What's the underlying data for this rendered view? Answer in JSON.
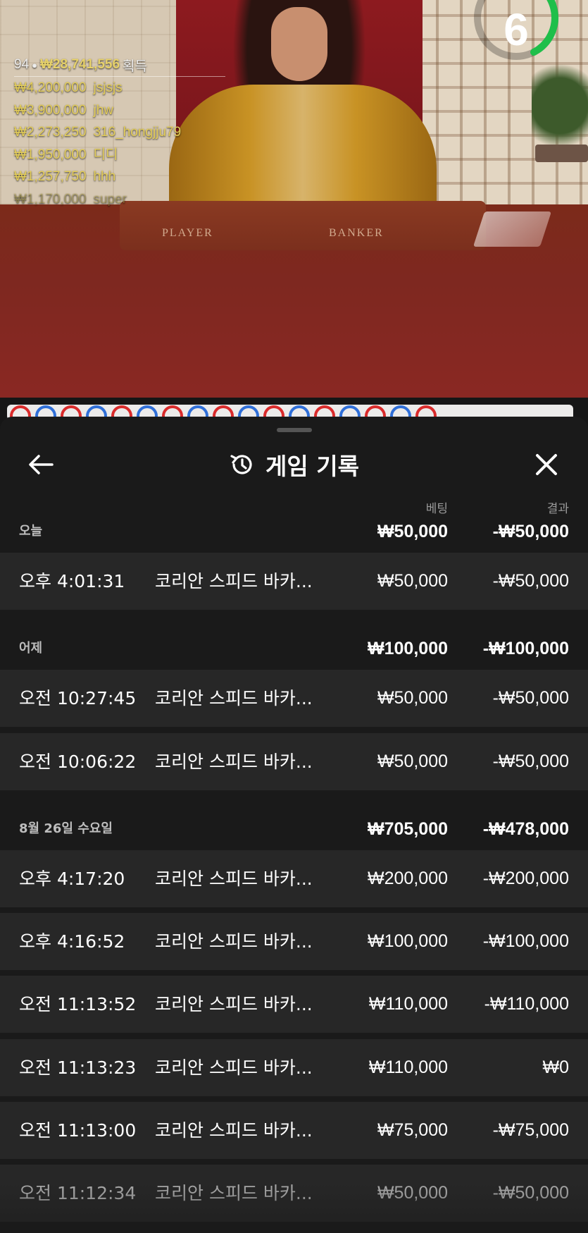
{
  "stream": {
    "countdown": "6",
    "table_labels": {
      "player": "PLAYER",
      "banker": "BANKER"
    }
  },
  "winners": {
    "count": "94",
    "total": "₩28,741,556",
    "suffix": "획득",
    "list": [
      {
        "amount": "₩4,200,000",
        "name": "jsjsjs"
      },
      {
        "amount": "₩3,900,000",
        "name": "jhw"
      },
      {
        "amount": "₩2,273,250",
        "name": "316_hongjju79"
      },
      {
        "amount": "₩1,950,000",
        "name": "디디"
      },
      {
        "amount": "₩1,257,750",
        "name": "hhh"
      },
      {
        "amount": "₩1,170,000",
        "name": "super"
      }
    ]
  },
  "history": {
    "title": "게임 기록",
    "columns": {
      "bet": "베팅",
      "result": "결과"
    },
    "groups": [
      {
        "label": "오늘",
        "bet_total": "₩50,000",
        "result_total": "-₩50,000",
        "rows": [
          {
            "time": "오후 4:01:31",
            "game": "코리안 스피드 바카...",
            "bet": "₩50,000",
            "result": "-₩50,000"
          }
        ]
      },
      {
        "label": "어제",
        "bet_total": "₩100,000",
        "result_total": "-₩100,000",
        "rows": [
          {
            "time": "오전 10:27:45",
            "game": "코리안 스피드 바카...",
            "bet": "₩50,000",
            "result": "-₩50,000"
          },
          {
            "time": "오전 10:06:22",
            "game": "코리안 스피드 바카...",
            "bet": "₩50,000",
            "result": "-₩50,000"
          }
        ]
      },
      {
        "label": "8월 26일 수요일",
        "bet_total": "₩705,000",
        "result_total": "-₩478,000",
        "rows": [
          {
            "time": "오후 4:17:20",
            "game": "코리안 스피드 바카...",
            "bet": "₩200,000",
            "result": "-₩200,000"
          },
          {
            "time": "오후 4:16:52",
            "game": "코리안 스피드 바카...",
            "bet": "₩100,000",
            "result": "-₩100,000"
          },
          {
            "time": "오전 11:13:52",
            "game": "코리안 스피드 바카...",
            "bet": "₩110,000",
            "result": "-₩110,000"
          },
          {
            "time": "오전 11:13:23",
            "game": "코리안 스피드 바카...",
            "bet": "₩110,000",
            "result": "₩0"
          },
          {
            "time": "오전 11:13:00",
            "game": "코리안 스피드 바카...",
            "bet": "₩75,000",
            "result": "-₩75,000"
          },
          {
            "time": "오전 11:12:34",
            "game": "코리안 스피드 바카...",
            "bet": "₩50,000",
            "result": "-₩50,000"
          }
        ]
      }
    ]
  },
  "colors": {
    "sheet_bg": "#1a1a1a",
    "row_bg": "#272727",
    "winner_gold": "#e3cd5a",
    "timer_green": "#1fbf4a"
  },
  "icons": {
    "back": "arrow-left-icon",
    "history": "history-clock-icon",
    "close": "close-icon"
  }
}
